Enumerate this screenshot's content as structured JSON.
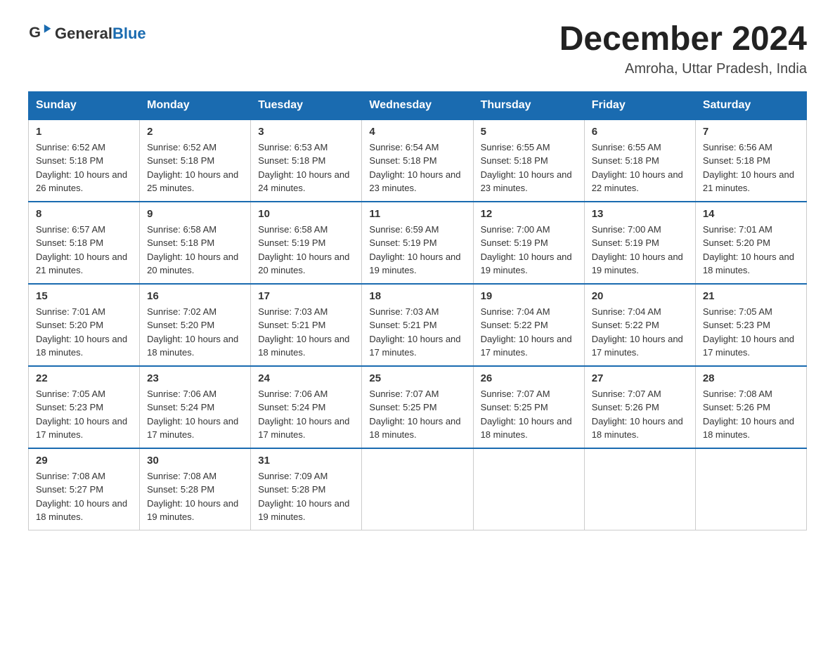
{
  "logo": {
    "text_general": "General",
    "text_blue": "Blue",
    "icon_color": "#1a6bb0"
  },
  "header": {
    "month_year": "December 2024",
    "location": "Amroha, Uttar Pradesh, India"
  },
  "days_of_week": [
    "Sunday",
    "Monday",
    "Tuesday",
    "Wednesday",
    "Thursday",
    "Friday",
    "Saturday"
  ],
  "weeks": [
    [
      {
        "day": "1",
        "sunrise": "6:52 AM",
        "sunset": "5:18 PM",
        "daylight": "10 hours and 26 minutes."
      },
      {
        "day": "2",
        "sunrise": "6:52 AM",
        "sunset": "5:18 PM",
        "daylight": "10 hours and 25 minutes."
      },
      {
        "day": "3",
        "sunrise": "6:53 AM",
        "sunset": "5:18 PM",
        "daylight": "10 hours and 24 minutes."
      },
      {
        "day": "4",
        "sunrise": "6:54 AM",
        "sunset": "5:18 PM",
        "daylight": "10 hours and 23 minutes."
      },
      {
        "day": "5",
        "sunrise": "6:55 AM",
        "sunset": "5:18 PM",
        "daylight": "10 hours and 23 minutes."
      },
      {
        "day": "6",
        "sunrise": "6:55 AM",
        "sunset": "5:18 PM",
        "daylight": "10 hours and 22 minutes."
      },
      {
        "day": "7",
        "sunrise": "6:56 AM",
        "sunset": "5:18 PM",
        "daylight": "10 hours and 21 minutes."
      }
    ],
    [
      {
        "day": "8",
        "sunrise": "6:57 AM",
        "sunset": "5:18 PM",
        "daylight": "10 hours and 21 minutes."
      },
      {
        "day": "9",
        "sunrise": "6:58 AM",
        "sunset": "5:18 PM",
        "daylight": "10 hours and 20 minutes."
      },
      {
        "day": "10",
        "sunrise": "6:58 AM",
        "sunset": "5:19 PM",
        "daylight": "10 hours and 20 minutes."
      },
      {
        "day": "11",
        "sunrise": "6:59 AM",
        "sunset": "5:19 PM",
        "daylight": "10 hours and 19 minutes."
      },
      {
        "day": "12",
        "sunrise": "7:00 AM",
        "sunset": "5:19 PM",
        "daylight": "10 hours and 19 minutes."
      },
      {
        "day": "13",
        "sunrise": "7:00 AM",
        "sunset": "5:19 PM",
        "daylight": "10 hours and 19 minutes."
      },
      {
        "day": "14",
        "sunrise": "7:01 AM",
        "sunset": "5:20 PM",
        "daylight": "10 hours and 18 minutes."
      }
    ],
    [
      {
        "day": "15",
        "sunrise": "7:01 AM",
        "sunset": "5:20 PM",
        "daylight": "10 hours and 18 minutes."
      },
      {
        "day": "16",
        "sunrise": "7:02 AM",
        "sunset": "5:20 PM",
        "daylight": "10 hours and 18 minutes."
      },
      {
        "day": "17",
        "sunrise": "7:03 AM",
        "sunset": "5:21 PM",
        "daylight": "10 hours and 18 minutes."
      },
      {
        "day": "18",
        "sunrise": "7:03 AM",
        "sunset": "5:21 PM",
        "daylight": "10 hours and 17 minutes."
      },
      {
        "day": "19",
        "sunrise": "7:04 AM",
        "sunset": "5:22 PM",
        "daylight": "10 hours and 17 minutes."
      },
      {
        "day": "20",
        "sunrise": "7:04 AM",
        "sunset": "5:22 PM",
        "daylight": "10 hours and 17 minutes."
      },
      {
        "day": "21",
        "sunrise": "7:05 AM",
        "sunset": "5:23 PM",
        "daylight": "10 hours and 17 minutes."
      }
    ],
    [
      {
        "day": "22",
        "sunrise": "7:05 AM",
        "sunset": "5:23 PM",
        "daylight": "10 hours and 17 minutes."
      },
      {
        "day": "23",
        "sunrise": "7:06 AM",
        "sunset": "5:24 PM",
        "daylight": "10 hours and 17 minutes."
      },
      {
        "day": "24",
        "sunrise": "7:06 AM",
        "sunset": "5:24 PM",
        "daylight": "10 hours and 17 minutes."
      },
      {
        "day": "25",
        "sunrise": "7:07 AM",
        "sunset": "5:25 PM",
        "daylight": "10 hours and 18 minutes."
      },
      {
        "day": "26",
        "sunrise": "7:07 AM",
        "sunset": "5:25 PM",
        "daylight": "10 hours and 18 minutes."
      },
      {
        "day": "27",
        "sunrise": "7:07 AM",
        "sunset": "5:26 PM",
        "daylight": "10 hours and 18 minutes."
      },
      {
        "day": "28",
        "sunrise": "7:08 AM",
        "sunset": "5:26 PM",
        "daylight": "10 hours and 18 minutes."
      }
    ],
    [
      {
        "day": "29",
        "sunrise": "7:08 AM",
        "sunset": "5:27 PM",
        "daylight": "10 hours and 18 minutes."
      },
      {
        "day": "30",
        "sunrise": "7:08 AM",
        "sunset": "5:28 PM",
        "daylight": "10 hours and 19 minutes."
      },
      {
        "day": "31",
        "sunrise": "7:09 AM",
        "sunset": "5:28 PM",
        "daylight": "10 hours and 19 minutes."
      },
      null,
      null,
      null,
      null
    ]
  ],
  "labels": {
    "sunrise": "Sunrise:",
    "sunset": "Sunset:",
    "daylight": "Daylight:"
  }
}
